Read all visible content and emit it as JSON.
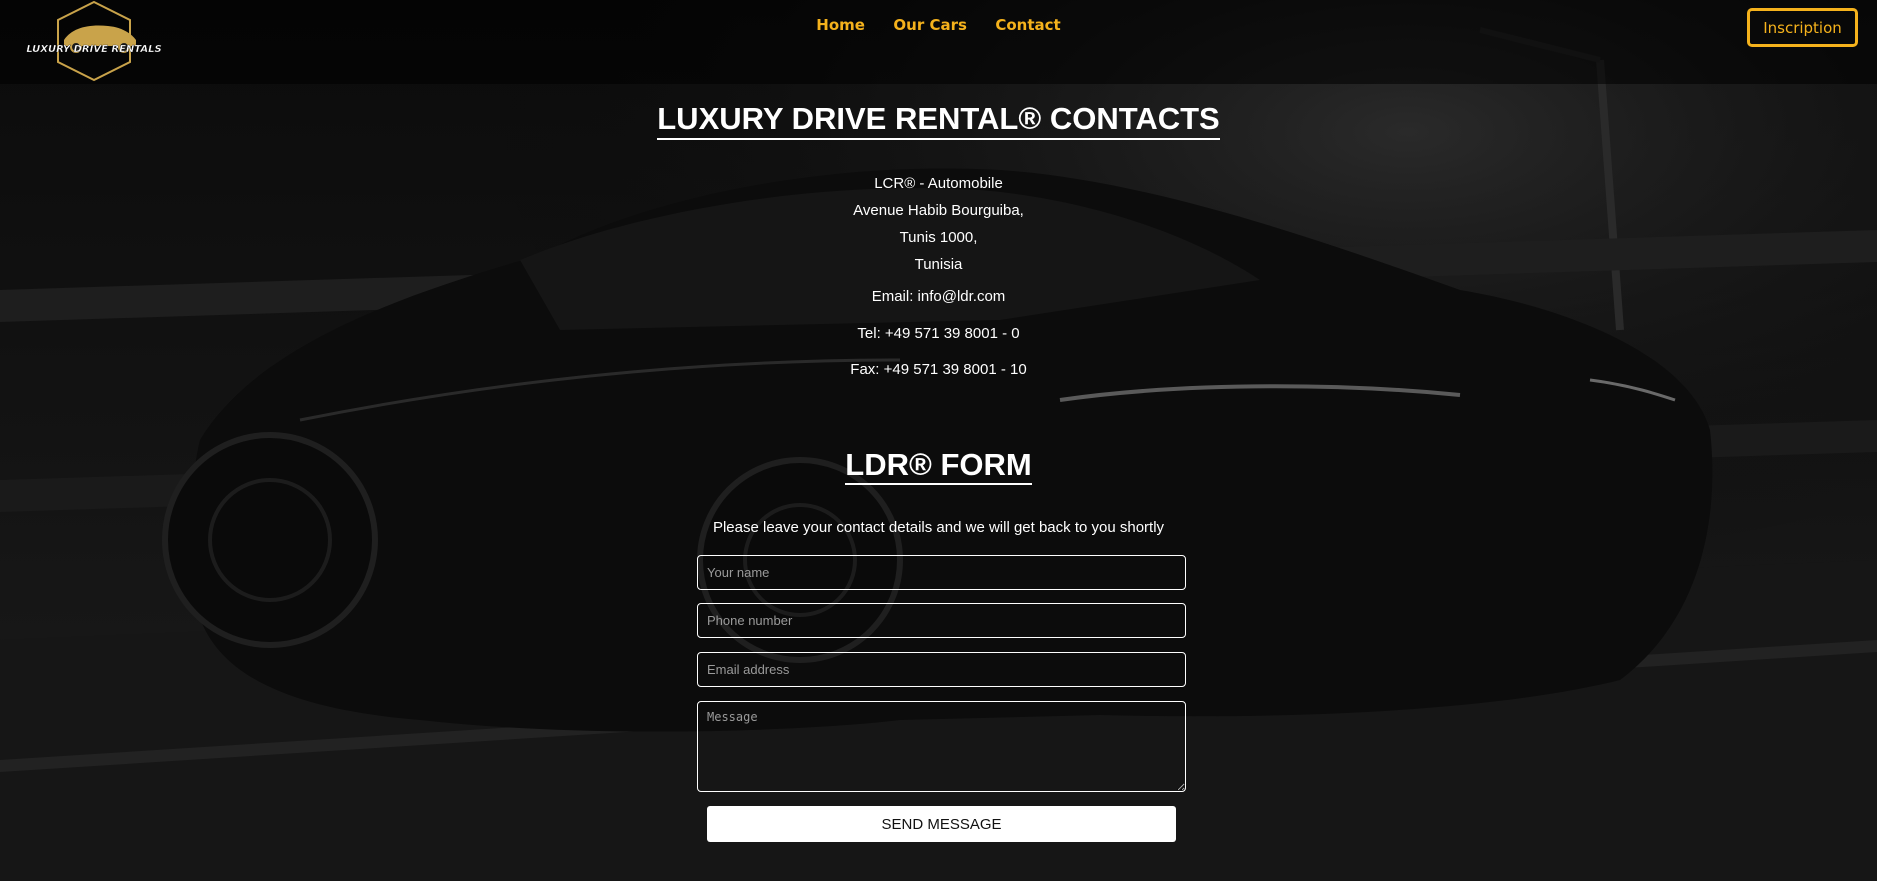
{
  "header": {
    "logo_text": "LUXURY DRIVE RENTALS",
    "nav": [
      "Home",
      "Our Cars",
      "Contact"
    ],
    "inscription_label": "Inscription"
  },
  "contacts": {
    "title": "LUXURY DRIVE RENTAL® CONTACTS",
    "address_lines": [
      "LCR® - Automobile",
      "Avenue Habib Bourguiba,",
      "Tunis 1000,",
      "Tunisia"
    ],
    "email": "Email: info@ldr.com",
    "tel": "Tel: +49 571 39 8001 - 0",
    "fax": "Fax: +49 571 39 8001 - 10"
  },
  "form": {
    "title": "LDR® FORM",
    "intro": "Please leave your contact details and we will get back to you shortly",
    "name_placeholder": "Your name",
    "phone_placeholder": "Phone number",
    "email_placeholder": "Email address",
    "message_placeholder": "Message",
    "send_label": "SEND MESSAGE"
  },
  "colors": {
    "accent": "#f5b21c",
    "background": "#070707",
    "text": "#ffffff"
  },
  "icons": {
    "logo": "car-in-hexagon-logo"
  }
}
